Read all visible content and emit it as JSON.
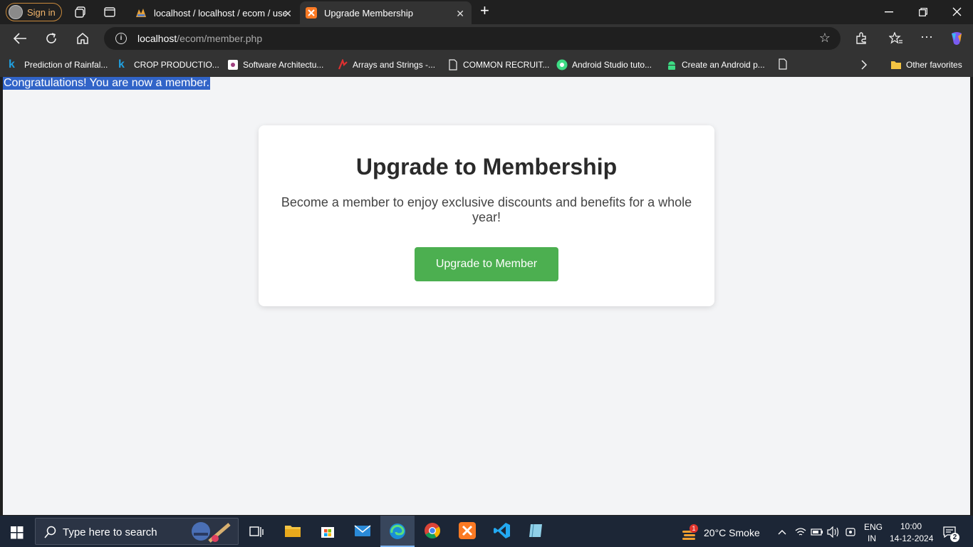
{
  "browser": {
    "signin_label": "Sign in",
    "tabs": [
      {
        "title": "localhost / localhost / ecom / use",
        "close": "✕"
      },
      {
        "title": "Upgrade Membership",
        "close": "✕"
      }
    ],
    "new_tab": "+",
    "url_host": "localhost",
    "url_path": "/ecom/member.php",
    "bookmarks": [
      "Prediction of Rainfal...",
      "CROP PRODUCTIO...",
      "Software Architectu...",
      "Arrays and Strings -...",
      "COMMON RECRUIT...",
      "Android Studio tuto...",
      "Create an Android p..."
    ],
    "other_favorites": "Other favorites"
  },
  "page": {
    "congrats": "Congratulations! You are now a member.",
    "heading": "Upgrade to Membership",
    "description": "Become a member to enjoy exclusive discounts and benefits for a whole year!",
    "button_label": "Upgrade to Member"
  },
  "taskbar": {
    "search_placeholder": "Type here to search",
    "weather": "20°C  Smoke",
    "weather_badge": "1",
    "lang_top": "ENG",
    "lang_bottom": "IN",
    "time": "10:00",
    "date": "14-12-2024",
    "notif_count": "2"
  },
  "colors": {
    "accent_button": "#4caf50",
    "selection": "#3164c8"
  }
}
